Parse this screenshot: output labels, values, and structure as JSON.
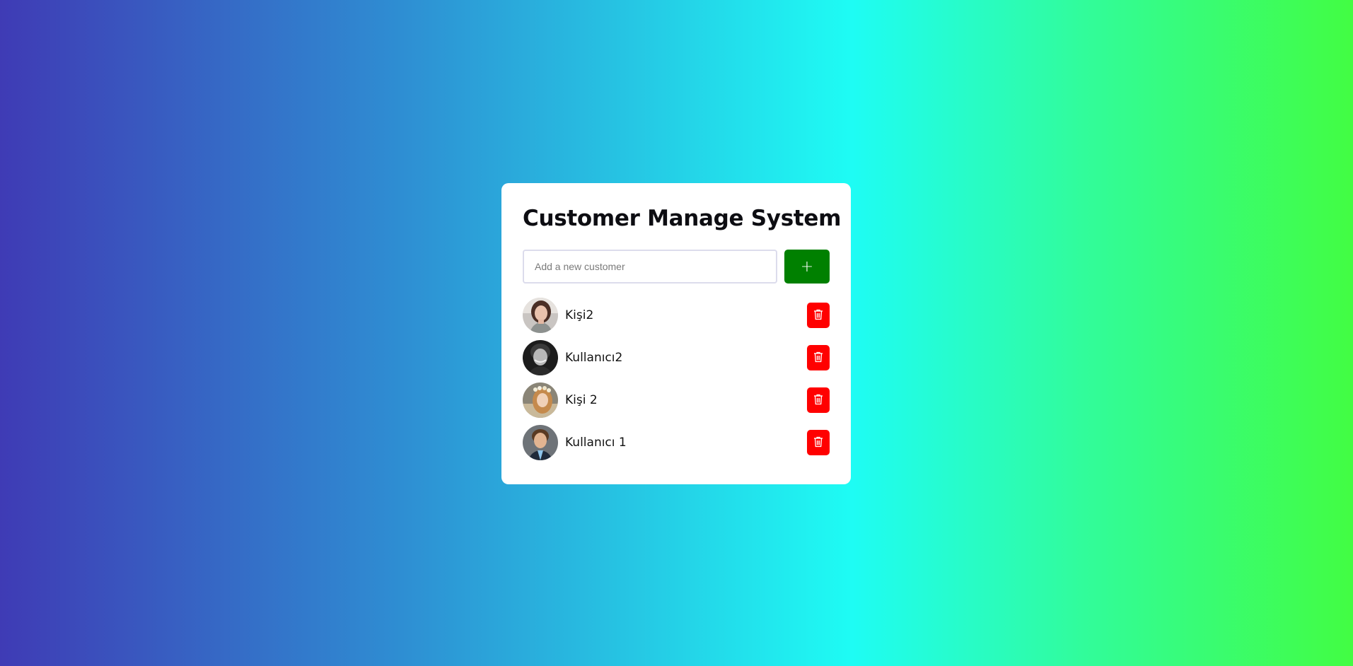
{
  "app": {
    "title": "Customer Manage System"
  },
  "form": {
    "placeholder": "Add a new customer",
    "value": "",
    "add_label": "+"
  },
  "customers": [
    {
      "name": "Kişi2",
      "avatar": "woman-photo-avatar"
    },
    {
      "name": "Kullanıcı2",
      "avatar": "man-bw-photo-avatar"
    },
    {
      "name": "Kişi 2",
      "avatar": "woman-flower-crown-photo-avatar"
    },
    {
      "name": "Kullanıcı 1",
      "avatar": "man-suit-photo-avatar"
    }
  ],
  "icons": {
    "delete": "trash-icon",
    "add": "plus-icon"
  },
  "colors": {
    "add_button": "#008000",
    "delete_button": "#ff0000",
    "card": "#ffffff"
  }
}
